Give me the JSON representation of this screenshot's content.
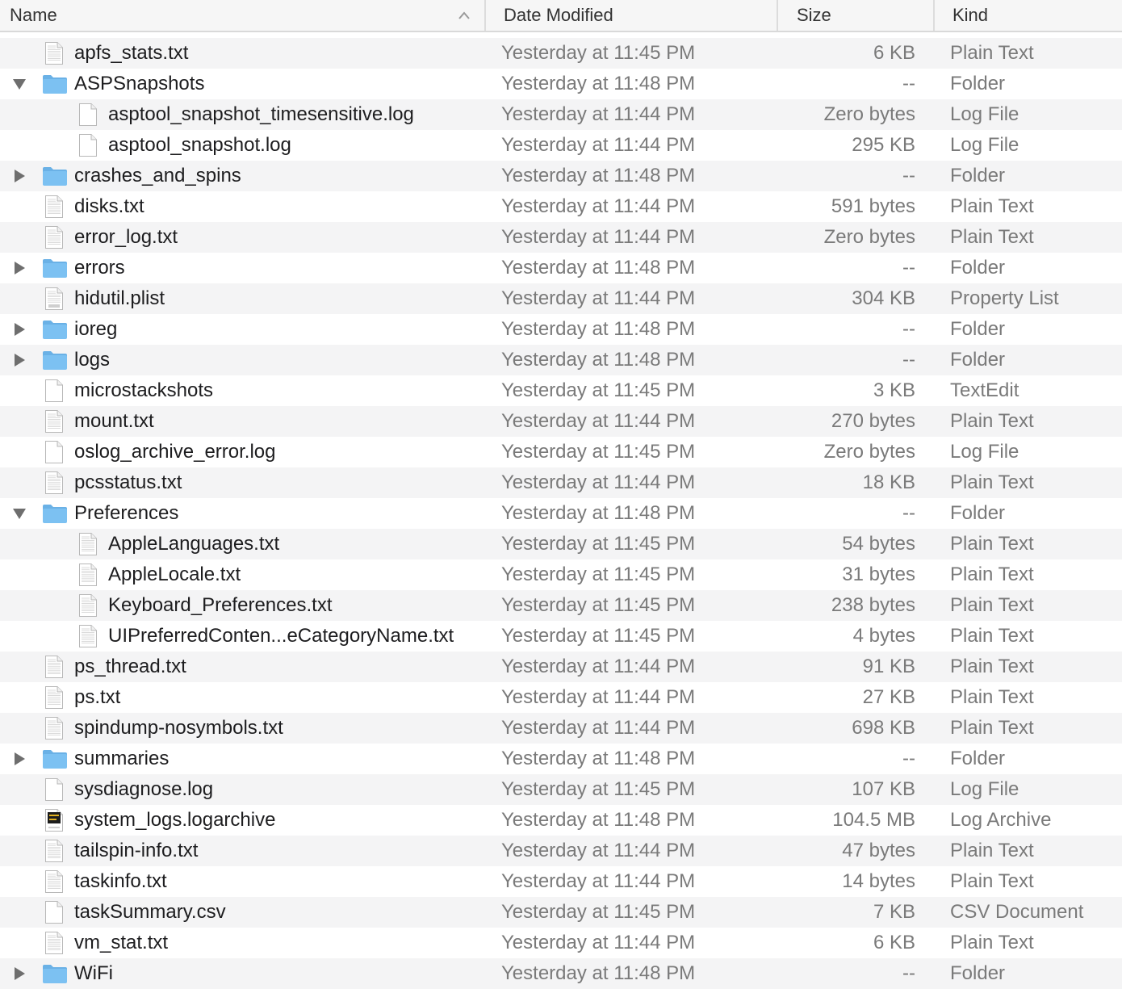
{
  "columns": {
    "name": "Name",
    "date": "Date Modified",
    "size": "Size",
    "kind": "Kind"
  },
  "colors": {
    "folder": "#7cc1f2",
    "folder_tab": "#6ab1e6",
    "row_alt": "#f4f4f5",
    "muted_text": "#7a7a7a"
  },
  "rows": [
    {
      "name": "apfs_stats.txt",
      "date": "Yesterday at 11:45 PM",
      "size": "6 KB",
      "kind": "Plain Text",
      "icon": "text-file-icon",
      "level": 0,
      "disclosure": ""
    },
    {
      "name": "ASPSnapshots",
      "date": "Yesterday at 11:48 PM",
      "size": "--",
      "kind": "Folder",
      "icon": "folder-icon",
      "level": 0,
      "disclosure": "expanded"
    },
    {
      "name": "asptool_snapshot_timesensitive.log",
      "date": "Yesterday at 11:44 PM",
      "size": "Zero bytes",
      "kind": "Log File",
      "icon": "blank-file-icon",
      "level": 1,
      "disclosure": ""
    },
    {
      "name": "asptool_snapshot.log",
      "date": "Yesterday at 11:44 PM",
      "size": "295 KB",
      "kind": "Log File",
      "icon": "blank-file-icon",
      "level": 1,
      "disclosure": ""
    },
    {
      "name": "crashes_and_spins",
      "date": "Yesterday at 11:48 PM",
      "size": "--",
      "kind": "Folder",
      "icon": "folder-icon",
      "level": 0,
      "disclosure": "collapsed"
    },
    {
      "name": "disks.txt",
      "date": "Yesterday at 11:44 PM",
      "size": "591 bytes",
      "kind": "Plain Text",
      "icon": "text-file-icon",
      "level": 0,
      "disclosure": ""
    },
    {
      "name": "error_log.txt",
      "date": "Yesterday at 11:44 PM",
      "size": "Zero bytes",
      "kind": "Plain Text",
      "icon": "text-file-icon",
      "level": 0,
      "disclosure": ""
    },
    {
      "name": "errors",
      "date": "Yesterday at 11:48 PM",
      "size": "--",
      "kind": "Folder",
      "icon": "folder-icon",
      "level": 0,
      "disclosure": "collapsed"
    },
    {
      "name": "hidutil.plist",
      "date": "Yesterday at 11:44 PM",
      "size": "304 KB",
      "kind": "Property List",
      "icon": "plist-file-icon",
      "level": 0,
      "disclosure": ""
    },
    {
      "name": "ioreg",
      "date": "Yesterday at 11:48 PM",
      "size": "--",
      "kind": "Folder",
      "icon": "folder-icon",
      "level": 0,
      "disclosure": "collapsed"
    },
    {
      "name": "logs",
      "date": "Yesterday at 11:48 PM",
      "size": "--",
      "kind": "Folder",
      "icon": "folder-icon",
      "level": 0,
      "disclosure": "collapsed"
    },
    {
      "name": "microstackshots",
      "date": "Yesterday at 11:45 PM",
      "size": "3 KB",
      "kind": "TextEdit",
      "icon": "blank-file-icon",
      "level": 0,
      "disclosure": ""
    },
    {
      "name": "mount.txt",
      "date": "Yesterday at 11:44 PM",
      "size": "270 bytes",
      "kind": "Plain Text",
      "icon": "text-file-icon",
      "level": 0,
      "disclosure": ""
    },
    {
      "name": "oslog_archive_error.log",
      "date": "Yesterday at 11:45 PM",
      "size": "Zero bytes",
      "kind": "Log File",
      "icon": "blank-file-icon",
      "level": 0,
      "disclosure": ""
    },
    {
      "name": "pcsstatus.txt",
      "date": "Yesterday at 11:44 PM",
      "size": "18 KB",
      "kind": "Plain Text",
      "icon": "text-file-icon",
      "level": 0,
      "disclosure": ""
    },
    {
      "name": "Preferences",
      "date": "Yesterday at 11:48 PM",
      "size": "--",
      "kind": "Folder",
      "icon": "folder-icon",
      "level": 0,
      "disclosure": "expanded"
    },
    {
      "name": "AppleLanguages.txt",
      "date": "Yesterday at 11:45 PM",
      "size": "54 bytes",
      "kind": "Plain Text",
      "icon": "text-file-icon",
      "level": 1,
      "disclosure": ""
    },
    {
      "name": "AppleLocale.txt",
      "date": "Yesterday at 11:45 PM",
      "size": "31 bytes",
      "kind": "Plain Text",
      "icon": "text-file-icon",
      "level": 1,
      "disclosure": ""
    },
    {
      "name": "Keyboard_Preferences.txt",
      "date": "Yesterday at 11:45 PM",
      "size": "238 bytes",
      "kind": "Plain Text",
      "icon": "text-file-icon",
      "level": 1,
      "disclosure": ""
    },
    {
      "name": "UIPreferredConten...eCategoryName.txt",
      "date": "Yesterday at 11:45 PM",
      "size": "4 bytes",
      "kind": "Plain Text",
      "icon": "text-file-icon",
      "level": 1,
      "disclosure": ""
    },
    {
      "name": "ps_thread.txt",
      "date": "Yesterday at 11:44 PM",
      "size": "91 KB",
      "kind": "Plain Text",
      "icon": "text-file-icon",
      "level": 0,
      "disclosure": ""
    },
    {
      "name": "ps.txt",
      "date": "Yesterday at 11:44 PM",
      "size": "27 KB",
      "kind": "Plain Text",
      "icon": "text-file-icon",
      "level": 0,
      "disclosure": ""
    },
    {
      "name": "spindump-nosymbols.txt",
      "date": "Yesterday at 11:44 PM",
      "size": "698 KB",
      "kind": "Plain Text",
      "icon": "text-file-icon",
      "level": 0,
      "disclosure": ""
    },
    {
      "name": "summaries",
      "date": "Yesterday at 11:48 PM",
      "size": "--",
      "kind": "Folder",
      "icon": "folder-icon",
      "level": 0,
      "disclosure": "collapsed"
    },
    {
      "name": "sysdiagnose.log",
      "date": "Yesterday at 11:45 PM",
      "size": "107 KB",
      "kind": "Log File",
      "icon": "blank-file-icon",
      "level": 0,
      "disclosure": ""
    },
    {
      "name": "system_logs.logarchive",
      "date": "Yesterday at 11:48 PM",
      "size": "104.5 MB",
      "kind": "Log Archive",
      "icon": "logarchive-icon",
      "level": 0,
      "disclosure": ""
    },
    {
      "name": "tailspin-info.txt",
      "date": "Yesterday at 11:44 PM",
      "size": "47 bytes",
      "kind": "Plain Text",
      "icon": "text-file-icon",
      "level": 0,
      "disclosure": ""
    },
    {
      "name": "taskinfo.txt",
      "date": "Yesterday at 11:44 PM",
      "size": "14 bytes",
      "kind": "Plain Text",
      "icon": "text-file-icon",
      "level": 0,
      "disclosure": ""
    },
    {
      "name": "taskSummary.csv",
      "date": "Yesterday at 11:45 PM",
      "size": "7 KB",
      "kind": "CSV Document",
      "icon": "blank-file-icon",
      "level": 0,
      "disclosure": ""
    },
    {
      "name": "vm_stat.txt",
      "date": "Yesterday at 11:44 PM",
      "size": "6 KB",
      "kind": "Plain Text",
      "icon": "text-file-icon",
      "level": 0,
      "disclosure": ""
    },
    {
      "name": "WiFi",
      "date": "Yesterday at 11:48 PM",
      "size": "--",
      "kind": "Folder",
      "icon": "folder-icon",
      "level": 0,
      "disclosure": "collapsed"
    }
  ]
}
